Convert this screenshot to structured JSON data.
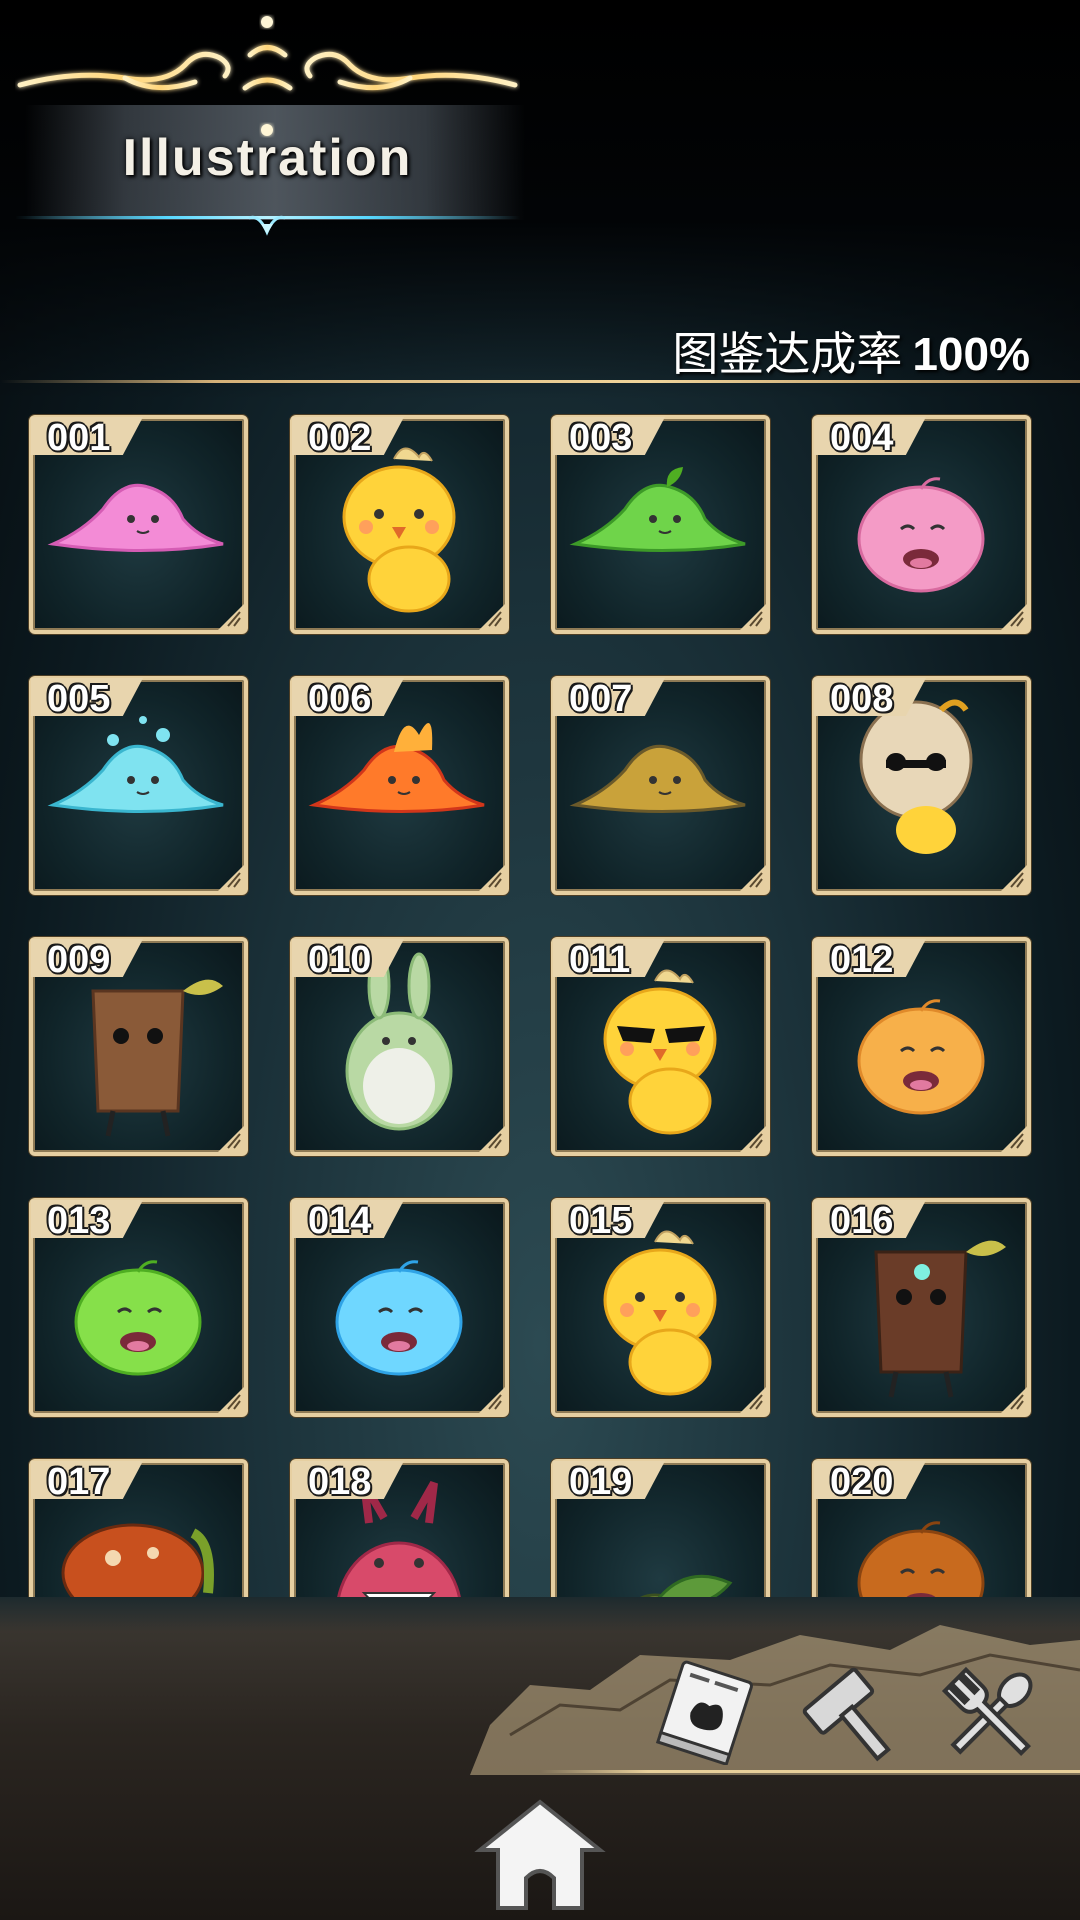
{
  "header": {
    "title": "Illustration"
  },
  "completion": {
    "label": "图鉴达成率",
    "value": "100%"
  },
  "cards": [
    {
      "number": "001",
      "creature": "pink-slime"
    },
    {
      "number": "002",
      "creature": "yellow-chick"
    },
    {
      "number": "003",
      "creature": "green-slime-sprout"
    },
    {
      "number": "004",
      "creature": "pink-blob"
    },
    {
      "number": "005",
      "creature": "blue-bubble-slime"
    },
    {
      "number": "006",
      "creature": "fire-slime"
    },
    {
      "number": "007",
      "creature": "rock-slime"
    },
    {
      "number": "008",
      "creature": "eggshell-chick"
    },
    {
      "number": "009",
      "creature": "tree-stump"
    },
    {
      "number": "010",
      "creature": "green-rabbit"
    },
    {
      "number": "011",
      "creature": "sunglasses-chick"
    },
    {
      "number": "012",
      "creature": "orange-blob"
    },
    {
      "number": "013",
      "creature": "green-blob"
    },
    {
      "number": "014",
      "creature": "blue-blob"
    },
    {
      "number": "015",
      "creature": "yellow-chick"
    },
    {
      "number": "016",
      "creature": "wood-golem"
    },
    {
      "number": "017",
      "creature": "mushroom"
    },
    {
      "number": "018",
      "creature": "red-monster"
    },
    {
      "number": "019",
      "creature": "leaf-sprite"
    },
    {
      "number": "020",
      "creature": "brown-blob"
    }
  ],
  "colors": {
    "card_border": "#e6cfa1",
    "gold": "#f0d49a",
    "cyan_glow": "#57d8ff"
  },
  "toolbar": {
    "icons": [
      "illustration-book-icon",
      "hammer-icon",
      "spoon-fork-icon"
    ],
    "home": "home-icon"
  }
}
